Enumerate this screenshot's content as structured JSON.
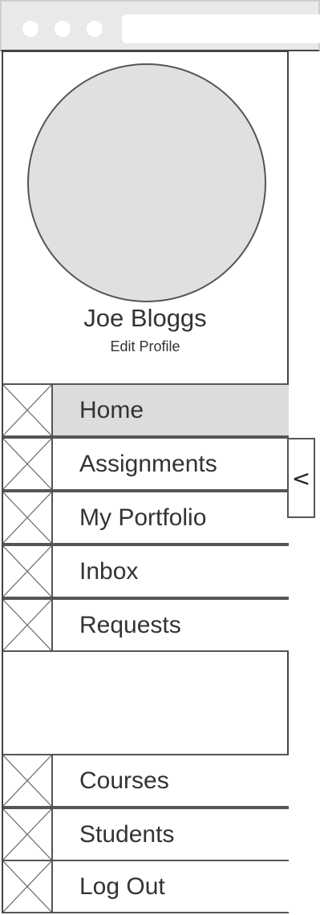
{
  "profile": {
    "name": "Joe Bloggs",
    "edit_label": "Edit Profile"
  },
  "nav": {
    "primary": [
      {
        "label": "Home",
        "icon": "placeholder-image-icon",
        "active": true
      },
      {
        "label": "Assignments",
        "icon": "placeholder-image-icon",
        "active": false
      },
      {
        "label": "My Portfolio",
        "icon": "placeholder-image-icon",
        "active": false
      },
      {
        "label": "Inbox",
        "icon": "placeholder-image-icon",
        "active": false
      },
      {
        "label": "Requests",
        "icon": "placeholder-image-icon",
        "active": false
      }
    ],
    "secondary": [
      {
        "label": "Courses",
        "icon": "placeholder-image-icon",
        "active": false
      },
      {
        "label": "Students",
        "icon": "placeholder-image-icon",
        "active": false
      },
      {
        "label": "Log Out",
        "icon": "placeholder-image-icon",
        "active": false
      }
    ]
  },
  "collapse_toggle": {
    "label": "<"
  },
  "colors": {
    "active_bg": "#dcdcdc",
    "avatar_bg": "#e0e0e0",
    "border": "#555555"
  }
}
